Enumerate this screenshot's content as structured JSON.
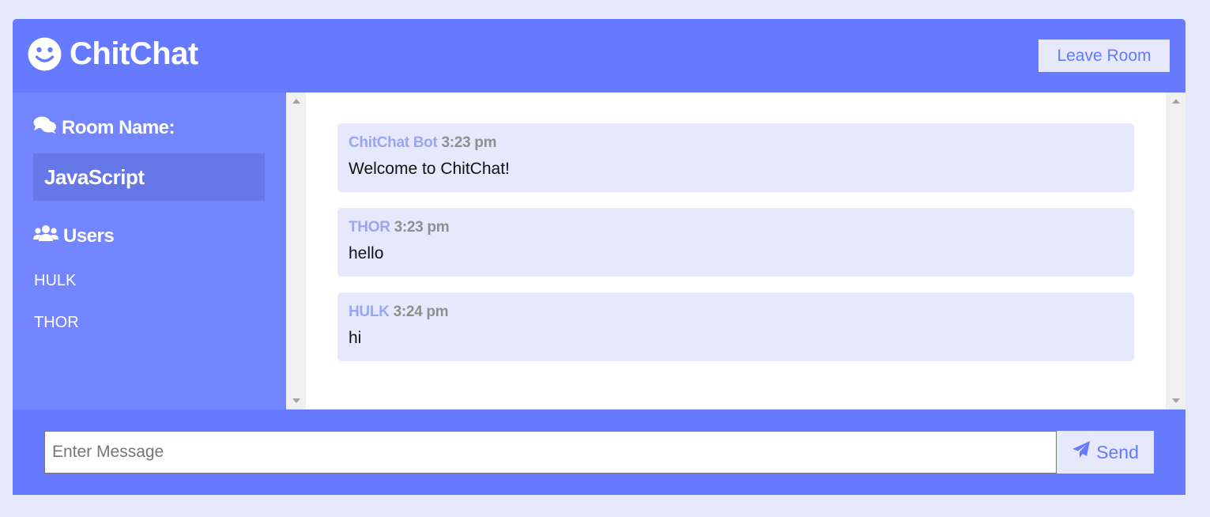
{
  "app": {
    "title": "ChitChat",
    "logo_icon": "smile-icon"
  },
  "header": {
    "leave_label": "Leave Room"
  },
  "sidebar": {
    "room_heading": "Room Name:",
    "room_icon": "comments-icon",
    "room_name": "JavaScript",
    "users_heading": "Users",
    "users_icon": "users-icon",
    "users": [
      "HULK",
      "THOR"
    ]
  },
  "messages": [
    {
      "author": "ChitChat Bot",
      "time": "3:23 pm",
      "text": "Welcome to ChitChat!"
    },
    {
      "author": "THOR",
      "time": "3:23 pm",
      "text": "hello"
    },
    {
      "author": "HULK",
      "time": "3:24 pm",
      "text": "hi"
    }
  ],
  "composer": {
    "placeholder": "Enter Message",
    "value": "",
    "send_label": "Send",
    "send_icon": "paper-plane-icon"
  },
  "colors": {
    "primary": "#667aff",
    "sidebar": "#7386ff",
    "room_box": "#6677e8",
    "light": "#e6e9fc",
    "author": "#9aa6f2",
    "time": "#8f8f8f"
  }
}
